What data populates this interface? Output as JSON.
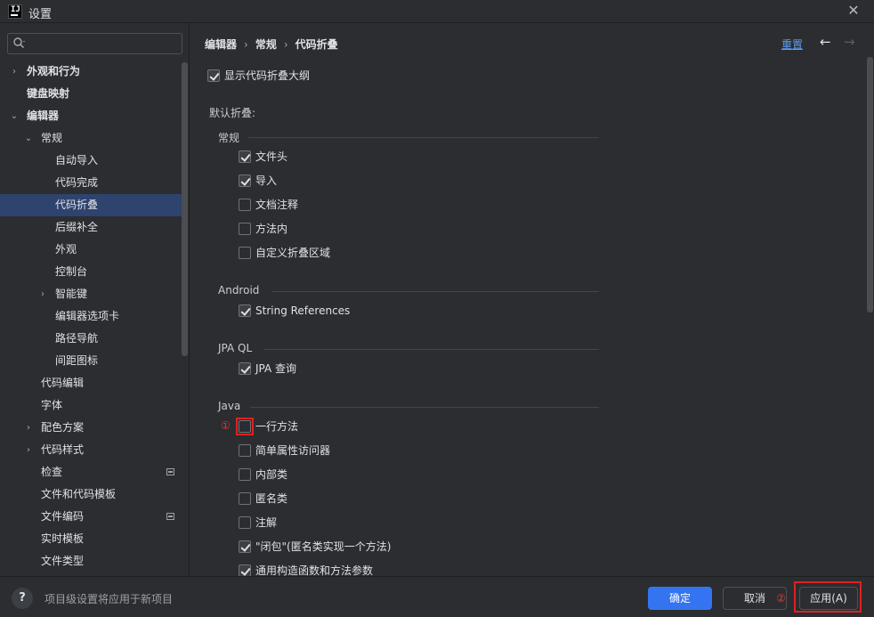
{
  "window": {
    "title": "设置",
    "logo": "IJ"
  },
  "search": {
    "placeholder": ""
  },
  "sidebar": {
    "items": [
      {
        "label": "外观和行为",
        "level": 0,
        "arrow": "›",
        "bold": true
      },
      {
        "label": "键盘映射",
        "level": 0,
        "arrow": "",
        "bold": true
      },
      {
        "label": "编辑器",
        "level": 0,
        "arrow": "⌄",
        "bold": true
      },
      {
        "label": "常规",
        "level": 1,
        "arrow": "⌄"
      },
      {
        "label": "自动导入",
        "level": 2,
        "arrow": ""
      },
      {
        "label": "代码完成",
        "level": 2,
        "arrow": ""
      },
      {
        "label": "代码折叠",
        "level": 2,
        "arrow": "",
        "selected": true
      },
      {
        "label": "后缀补全",
        "level": 2,
        "arrow": ""
      },
      {
        "label": "外观",
        "level": 2,
        "arrow": ""
      },
      {
        "label": "控制台",
        "level": 2,
        "arrow": ""
      },
      {
        "label": "智能键",
        "level": 2,
        "arrow": "›"
      },
      {
        "label": "编辑器选项卡",
        "level": 2,
        "arrow": ""
      },
      {
        "label": "路径导航",
        "level": 2,
        "arrow": ""
      },
      {
        "label": "间距图标",
        "level": 2,
        "arrow": ""
      },
      {
        "label": "代码编辑",
        "level": 1,
        "arrow": ""
      },
      {
        "label": "字体",
        "level": 1,
        "arrow": ""
      },
      {
        "label": "配色方案",
        "level": 1,
        "arrow": "›"
      },
      {
        "label": "代码样式",
        "level": 1,
        "arrow": "›"
      },
      {
        "label": "检查",
        "level": 1,
        "arrow": "",
        "badge": true
      },
      {
        "label": "文件和代码模板",
        "level": 1,
        "arrow": ""
      },
      {
        "label": "文件编码",
        "level": 1,
        "arrow": "",
        "badge": true
      },
      {
        "label": "实时模板",
        "level": 1,
        "arrow": ""
      },
      {
        "label": "文件类型",
        "level": 1,
        "arrow": ""
      }
    ]
  },
  "header": {
    "breadcrumb": [
      "编辑器",
      "常规",
      "代码折叠"
    ],
    "reset": "重置",
    "back_icon": "←",
    "forward_icon": "→"
  },
  "content": {
    "show_outline": {
      "label": "显示代码折叠大纲",
      "checked": true
    },
    "default_fold_label": "默认折叠:",
    "groups": [
      {
        "title": "常规",
        "items": [
          {
            "label": "文件头",
            "checked": true
          },
          {
            "label": "导入",
            "checked": true
          },
          {
            "label": "文档注释",
            "checked": false
          },
          {
            "label": "方法内",
            "checked": false
          },
          {
            "label": "自定义折叠区域",
            "checked": false
          }
        ]
      },
      {
        "title": "Android",
        "items": [
          {
            "label": "String References",
            "checked": true
          }
        ]
      },
      {
        "title": "JPA QL",
        "items": [
          {
            "label": "JPA 查询",
            "checked": true
          }
        ]
      },
      {
        "title": "Java",
        "items": [
          {
            "label": "一行方法",
            "checked": false
          },
          {
            "label": "简单属性访问器",
            "checked": false
          },
          {
            "label": "内部类",
            "checked": false
          },
          {
            "label": "匿名类",
            "checked": false
          },
          {
            "label": "注解",
            "checked": false
          },
          {
            "label": "\"闭包\"(匿名类实现一个方法)",
            "checked": true
          },
          {
            "label": "通用构造函数和方法参数",
            "checked": true
          }
        ]
      }
    ],
    "annotation_1": "①",
    "annotation_2": "②"
  },
  "footer": {
    "help": "?",
    "note": "项目级设置将应用于新项目",
    "ok": "确定",
    "cancel": "取消",
    "apply": "应用(A)"
  },
  "colors": {
    "accent": "#3574f0",
    "selection": "#2e436e",
    "link": "#5d9df5",
    "annotation": "#e02020"
  }
}
